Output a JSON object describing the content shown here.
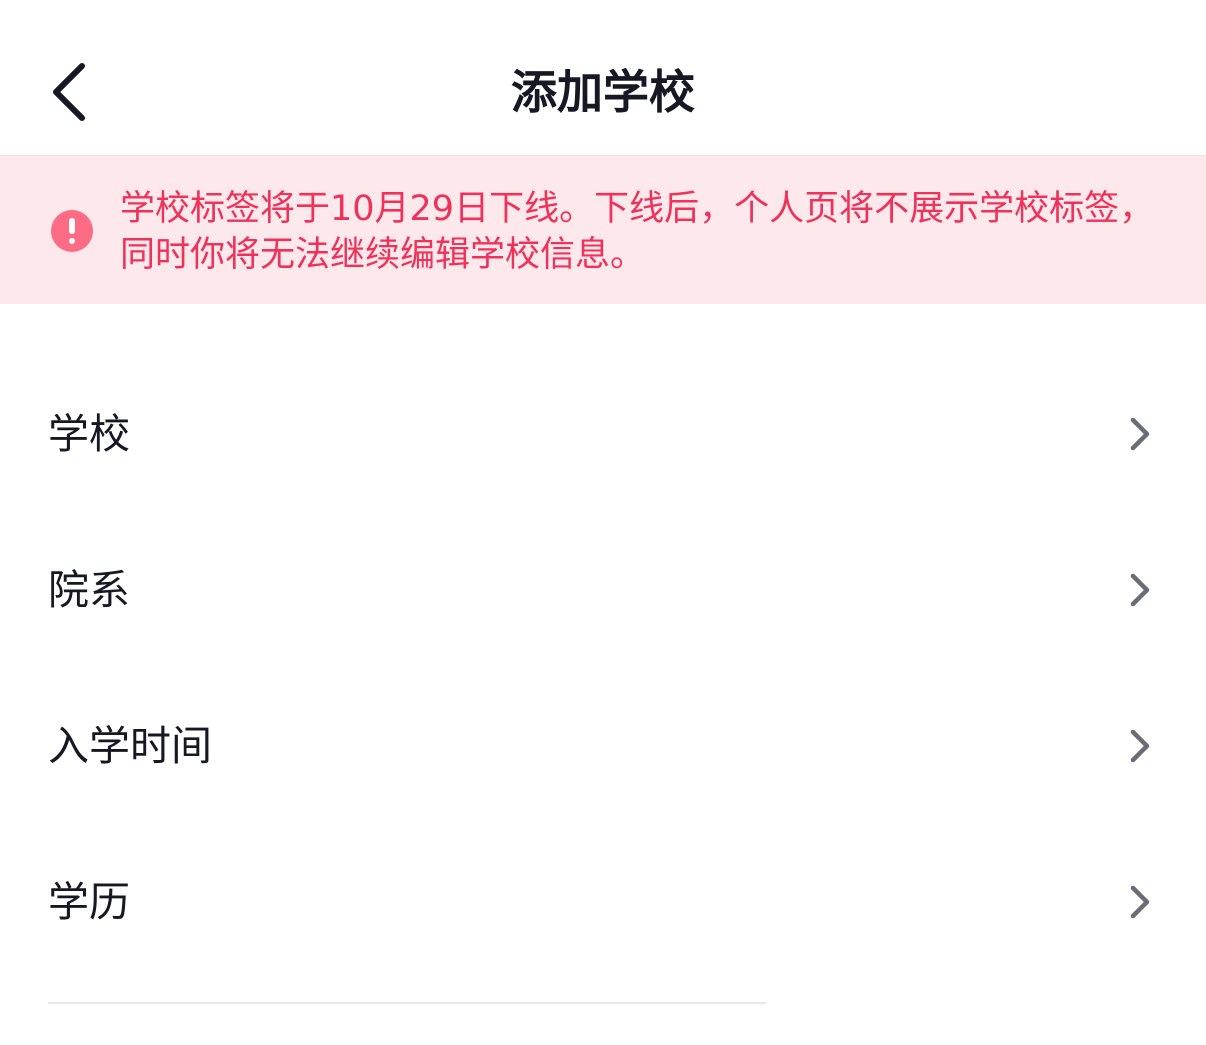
{
  "header": {
    "title": "添加学校",
    "back_icon": "chevron-left-icon"
  },
  "notice": {
    "icon": "exclamation-circle-icon",
    "text": "学校标签将于10月29日下线。下线后，个人页将不展示学校标签，同时你将无法继续编辑学校信息。",
    "text_color": "#f0315a",
    "background_color": "#fde9ec",
    "icon_color": "#fd6b84"
  },
  "form": {
    "rows": [
      {
        "label": "学校",
        "icon": "chevron-right-icon"
      },
      {
        "label": "院系",
        "icon": "chevron-right-icon"
      },
      {
        "label": "入学时间",
        "icon": "chevron-right-icon"
      },
      {
        "label": "学历",
        "icon": "chevron-right-icon"
      }
    ]
  }
}
